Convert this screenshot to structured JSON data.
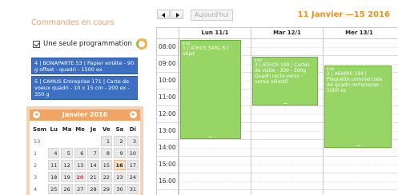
{
  "left": {
    "title": "Commandes en cours",
    "programmation_label": "Une seule programmation",
    "orders": [
      "4 | BONAPARTE 53 | Papier entête - 90 g offset - quadri - 1500 ex",
      "5 | CAMUS Entreprise 171 | Carte de voeux quadri - 10 x 15 cm - 200 ex - 350 g"
    ]
  },
  "datepicker": {
    "title": "Janvier 2016",
    "weekday_headers": [
      "Sem",
      "Lu",
      "Ma",
      "Me",
      "Je",
      "Ve",
      "Sa",
      "Di"
    ],
    "rows": [
      [
        "53",
        "",
        "",
        "",
        "",
        "1",
        "2",
        "3"
      ],
      [
        "1",
        "4",
        "5",
        "6",
        "7",
        "8",
        "9",
        "10"
      ],
      [
        "2",
        "11",
        "12",
        "13",
        "14",
        "15",
        "16",
        "17"
      ],
      [
        "3",
        "18",
        "19",
        "20",
        "21",
        "22",
        "23",
        "24"
      ],
      [
        "4",
        "25",
        "26",
        "27",
        "28",
        "29",
        "30",
        "31"
      ]
    ],
    "today": "20",
    "selected": "16"
  },
  "calendar": {
    "today_label": "Aujourd'hui",
    "title": "11 Janvier —15 2016",
    "days": [
      "Lun 11/1",
      "Mar 12/1",
      "Mer 13/1"
    ],
    "times": [
      "08:00",
      "09:00",
      "10:00",
      "11:00",
      "12:00",
      "13:00",
      "14:00",
      "15:00",
      "16:00"
    ],
    "events": [
      {
        "day": 0,
        "start": 8.0,
        "end": 14.0,
        "time": "8:00",
        "text": "1 | ATHOS SARL 6 | objet"
      },
      {
        "day": 1,
        "start": 9.0,
        "end": 12.0,
        "time": "9:00",
        "text": "3 | ATHOS 199 | Cartes de visite - 300 - 300g Quadri recto-verso - vernis sélectif"
      },
      {
        "day": 2,
        "start": 9.5,
        "end": 14.5,
        "time": "9:30",
        "text": "2 | ARAMIS 194 | Plaquette commerciale A4 quadri recto/verso - 1000 ex"
      }
    ]
  },
  "colors": {
    "accent_orange": "#e59225",
    "event_green": "#97d565",
    "order_blue": "#3d6fc3",
    "datepicker_header": "#f2a465",
    "today_red": "#d43c2a"
  }
}
